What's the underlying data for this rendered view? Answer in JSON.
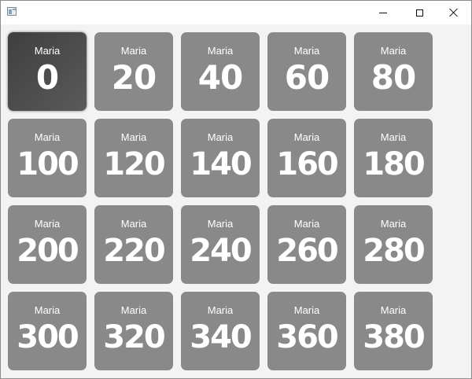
{
  "window": {
    "icon": "app-window-icon",
    "controls": [
      {
        "name": "minimize",
        "icon": "minimize-icon"
      },
      {
        "name": "maximize",
        "icon": "maximize-icon"
      },
      {
        "name": "close",
        "icon": "close-icon"
      }
    ]
  },
  "tiles": [
    {
      "name": "Maria",
      "value": "0",
      "selected": true
    },
    {
      "name": "Maria",
      "value": "20"
    },
    {
      "name": "Maria",
      "value": "40"
    },
    {
      "name": "Maria",
      "value": "60"
    },
    {
      "name": "Maria",
      "value": "80"
    },
    {
      "name": "Maria",
      "value": "100"
    },
    {
      "name": "Maria",
      "value": "120"
    },
    {
      "name": "Maria",
      "value": "140"
    },
    {
      "name": "Maria",
      "value": "160"
    },
    {
      "name": "Maria",
      "value": "180"
    },
    {
      "name": "Maria",
      "value": "200"
    },
    {
      "name": "Maria",
      "value": "220"
    },
    {
      "name": "Maria",
      "value": "240"
    },
    {
      "name": "Maria",
      "value": "260"
    },
    {
      "name": "Maria",
      "value": "280"
    },
    {
      "name": "Maria",
      "value": "300"
    },
    {
      "name": "Maria",
      "value": "320"
    },
    {
      "name": "Maria",
      "value": "340"
    },
    {
      "name": "Maria",
      "value": "360"
    },
    {
      "name": "Maria",
      "value": "380"
    }
  ],
  "colors": {
    "tile": "#898989",
    "tile_selected": "#4a4a4a",
    "text": "#ffffff",
    "window_bg": "#f3f3f3"
  }
}
